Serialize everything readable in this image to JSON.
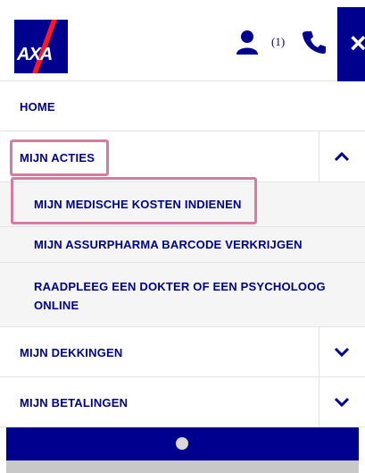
{
  "header": {
    "logo_text": "AXA",
    "user_icon": "user-icon",
    "user_count": "(1)",
    "phone_icon": "phone-icon",
    "close_label": "×"
  },
  "menu": {
    "home": "HOME",
    "mijn_acties": {
      "label": "MIJN ACTIES",
      "expanded": true,
      "items": [
        "MIJN MEDISCHE KOSTEN INDIENEN",
        "MIJN ASSURPHARMA BARCODE VERKRIJGEN",
        "RAADPLEEG EEN DOKTER OF EEN PSYCHOLOOG",
        "ONLINE"
      ]
    },
    "mijn_dekkingen": "MIJN DEKKINGEN",
    "mijn_betalingen": "MIJN BETALINGEN"
  },
  "colors": {
    "brand": "#00008f",
    "highlight": "#d77ca0",
    "submenu_bg": "#f5f5f5"
  }
}
